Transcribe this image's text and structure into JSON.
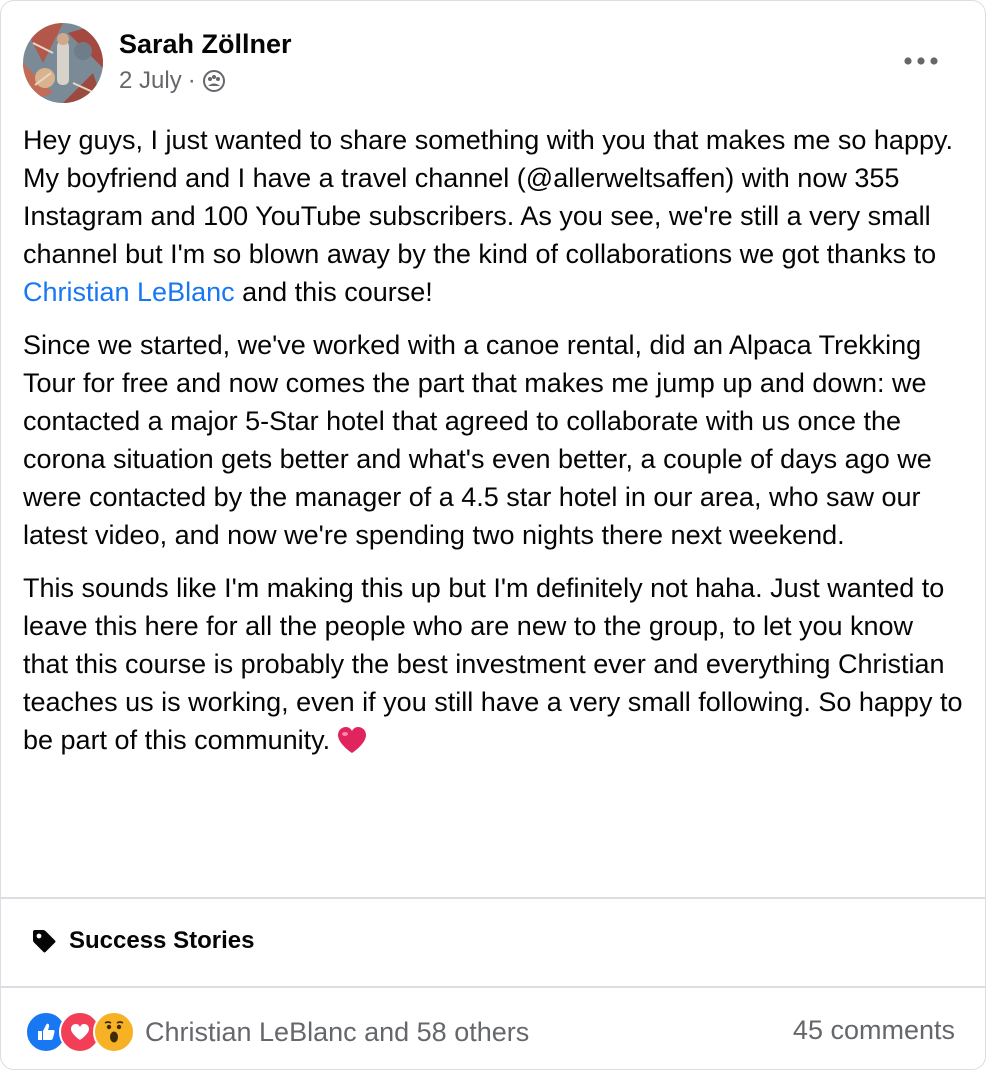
{
  "post": {
    "author": "Sarah Zöllner",
    "date": "2 July",
    "separator": "·",
    "privacy_icon": "group-icon",
    "more_icon": "ellipsis-icon",
    "paragraphs": {
      "p1_before": "Hey guys, I just wanted to share something with you that makes me so happy. My boyfriend and I have a travel channel (@allerweltsaffen) with now 355 Instagram and 100 YouTube subscribers. As you see, we're still a very small channel but I'm so blown away by the kind of collaborations we got thanks to ",
      "p1_mention": "Christian LeBlanc",
      "p1_after": " and this course!",
      "p2": "Since we started, we've worked with a canoe rental, did an Alpaca Trekking Tour for free and now comes the part that makes me jump up and down: we contacted a major 5-Star hotel that agreed to collaborate with us once the corona situation gets better and what's even better, a couple of days ago we were contacted by the manager of a 4.5 star hotel in our area, who saw our latest video, and now we're spending two nights there next weekend.",
      "p3": "This sounds like I'm making this up but I'm definitely not haha. Just wanted to leave this here for all the people who are new to the group, to let you know that this course is probably the best investment ever and everything Christian teaches us is working, even if you still have a very small following. So happy to be part of this community."
    },
    "emoji": "heart-emoji"
  },
  "topic": {
    "icon": "tag-icon",
    "label": "Success Stories"
  },
  "footer": {
    "reaction_icons": [
      "like-icon",
      "love-icon",
      "wow-icon"
    ],
    "reactions_text": "Christian LeBlanc and 58 others",
    "comments_text": "45 comments"
  },
  "colors": {
    "link": "#1877f2",
    "secondary_text": "#65676b",
    "like": "#1877f2",
    "love": "#f33e58",
    "wow": "#f7b125",
    "heart": "#e0245e"
  }
}
